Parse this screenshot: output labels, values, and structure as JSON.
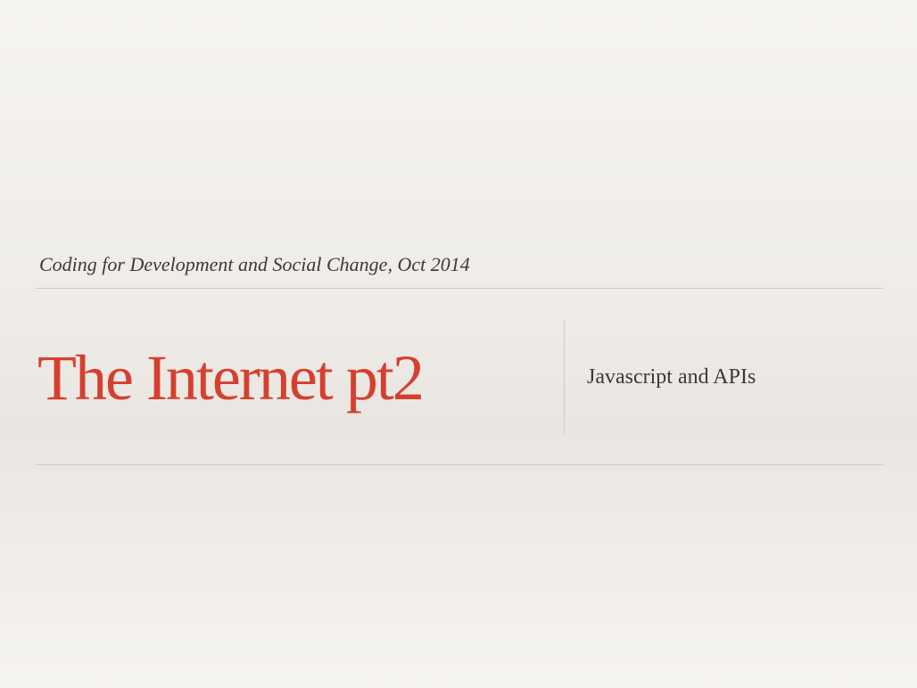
{
  "slide": {
    "kicker": "Coding for Development and Social Change, Oct 2014",
    "title": "The Internet pt2",
    "subtitle": "Javascript and APIs"
  },
  "colors": {
    "title": "#d63f2f",
    "text": "#3a3a3a",
    "rule": "#cdc9c3",
    "background": "#f3f0eb"
  }
}
